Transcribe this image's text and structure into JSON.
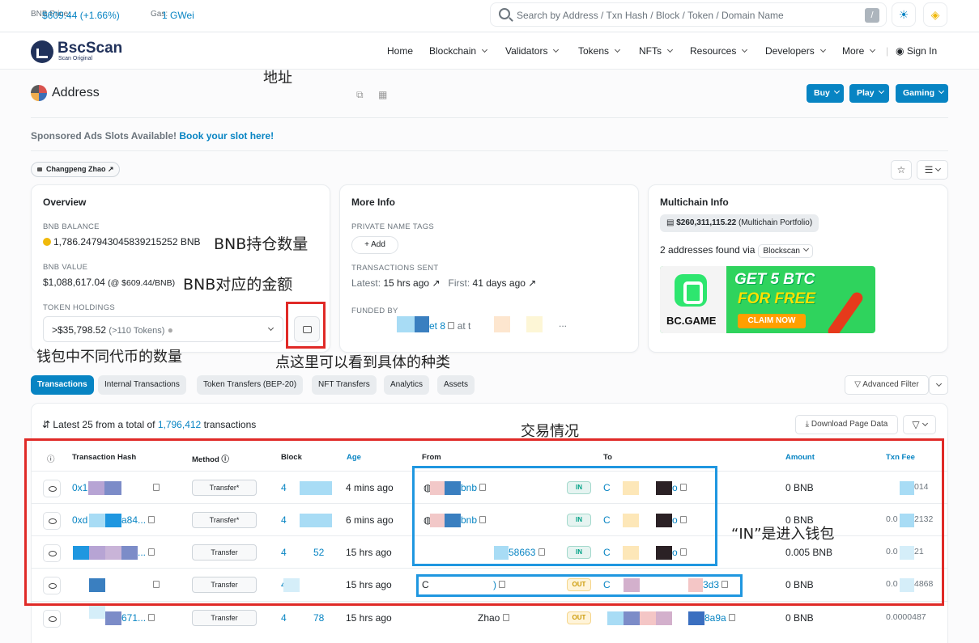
{
  "topbar": {
    "bnb_price_label": "BNB Price:",
    "bnb_price_value": "$609.44 (+1.66%)",
    "gas_label": "Gas:",
    "gas_value": "1 GWei",
    "search_placeholder": "Search by Address / Txn Hash / Block / Token / Domain Name",
    "search_shortcut": "/"
  },
  "nav": {
    "brand": "BscScan",
    "brand_sub": "Scan Original",
    "items": [
      "Home",
      "Blockchain",
      "Validators",
      "Tokens",
      "NFTs",
      "Resources",
      "Developers",
      "More"
    ],
    "sign_in": "Sign In"
  },
  "page": {
    "title": "Address",
    "buttons": [
      "Buy",
      "Play",
      "Gaming"
    ],
    "sponsored_text": "Sponsored Ads Slots Available!",
    "sponsored_link": "Book your slot here!",
    "name_tag": "Changpeng Zhao"
  },
  "overview": {
    "title": "Overview",
    "bnb_balance_label": "BNB BALANCE",
    "bnb_balance_value": "1,786.247943045839215252 BNB",
    "bnb_value_label": "BNB VALUE",
    "bnb_value_value": "$1,088,617.04",
    "bnb_value_rate": "(@ $609.44/BNB)",
    "token_holdings_label": "TOKEN HOLDINGS",
    "token_holdings_value": ">$35,798.52",
    "token_holdings_count": "(>110 Tokens)"
  },
  "more_info": {
    "title": "More Info",
    "private_tags_label": "PRIVATE NAME TAGS",
    "add_label": "+ Add",
    "tx_sent_label": "TRANSACTIONS SENT",
    "latest_label": "Latest:",
    "latest_value": "15 hrs ago",
    "first_label": "First:",
    "first_value": "41 days ago",
    "funded_by_label": "FUNDED BY",
    "funded_fragment": "et 8",
    "funded_at": "at t",
    "funded_ellipsis": "..."
  },
  "multichain": {
    "title": "Multichain Info",
    "portfolio_value": "$260,311,115.22",
    "portfolio_label": "(Multichain Portfolio)",
    "found_text": "2 addresses found via",
    "blockscan": "Blockscan",
    "banner_brand": "BC.GAME",
    "banner_line1": "GET 5 BTC",
    "banner_line2": "FOR FREE",
    "banner_cta": "CLAIM NOW"
  },
  "tabs": [
    "Transactions",
    "Internal Transactions",
    "Token Transfers (BEP-20)",
    "NFT Transfers",
    "Analytics",
    "Assets"
  ],
  "advanced_filter": "Advanced Filter",
  "table": {
    "summary_prefix": "Latest 25 from a total of",
    "summary_count": "1,796,412",
    "summary_suffix": "transactions",
    "download": "Download Page Data",
    "headers": [
      "Transaction Hash",
      "Method",
      "Block",
      "Age",
      "From",
      "To",
      "Amount",
      "Txn Fee"
    ],
    "rows": [
      {
        "hash": "0x1",
        "method": "Transfer*",
        "block": "4",
        "age": "4 mins ago",
        "from": "bnb",
        "dir": "IN",
        "to": "C",
        "to_tail": "o",
        "amount": "0 BNB",
        "fee": "014"
      },
      {
        "hash": "0xd",
        "hash_tail": "a84...",
        "method": "Transfer*",
        "block": "4",
        "age": "6 mins ago",
        "from": "bnb",
        "dir": "IN",
        "to": "C",
        "to_tail": "o",
        "amount": "0 BNB",
        "fee": "0.0",
        "fee_tail": "2132"
      },
      {
        "hash": "",
        "hash_tail": "...",
        "method": "Transfer",
        "block": "4",
        "block_tail": "52",
        "age": "15 hrs ago",
        "from": "58663",
        "dir": "IN",
        "to": "C",
        "to_tail": "o",
        "amount": "0.005 BNB",
        "fee": "0.0",
        "fee_tail": "21"
      },
      {
        "hash": "",
        "method": "Transfer",
        "block": "4",
        "age": "15 hrs ago",
        "from": "C",
        "from_tail": ")",
        "dir": "OUT",
        "to": "C",
        "to_tail": "3d3",
        "amount": "0 BNB",
        "fee": "0.0",
        "fee_tail": "4868"
      },
      {
        "hash": "",
        "hash_tail": "671...",
        "method": "Transfer",
        "block": "4",
        "block_tail": "78",
        "age": "15 hrs ago",
        "from": "Zhao",
        "dir": "OUT",
        "to": "",
        "to_tail": "8a9a",
        "amount": "0 BNB",
        "fee": "0.0000487"
      }
    ]
  },
  "annotations": {
    "address": "地址",
    "bnb_holdings": "BNB持仓数量",
    "bnb_value": "BNB对应的金额",
    "token_count": "钱包中不同代币的数量",
    "click_here": "点这里可以看到具体的种类",
    "tx_status": "交易情况",
    "in_means": "“IN”是进入钱包"
  },
  "colors": {
    "accent": "#0784c3",
    "annotation_red": "#e02a27",
    "annotation_blue": "#1f97e0"
  }
}
